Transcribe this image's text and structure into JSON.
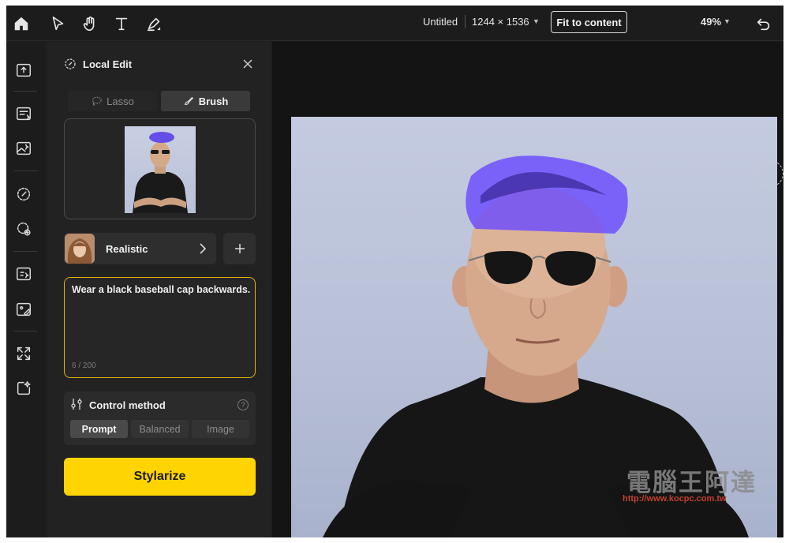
{
  "topbar": {
    "tools": [
      "home-icon",
      "select-icon",
      "hand-icon",
      "text-icon",
      "pen-icon"
    ],
    "doc_title": "Untitled",
    "doc_size": "1244 × 1536",
    "fit_button": "Fit to content",
    "zoom": "49%"
  },
  "panel": {
    "title": "Local Edit",
    "mode_tabs": {
      "lasso": "Lasso",
      "brush": "Brush"
    },
    "style": {
      "label": "Realistic"
    },
    "prompt": {
      "text": "Wear a black baseball cap backwards.",
      "count": "6 / 200"
    },
    "control": {
      "title": "Control method",
      "options": [
        "Prompt",
        "Balanced",
        "Image"
      ],
      "selected": "Prompt"
    },
    "stylize_button": "Stylarize"
  },
  "canvas": {
    "watermark": "電腦王阿達",
    "watermark_url": "http://www.kocpc.com.tw"
  },
  "colors": {
    "accent": "#ffd400",
    "mask": "#6a4cff",
    "background": "#1c1c1c"
  }
}
